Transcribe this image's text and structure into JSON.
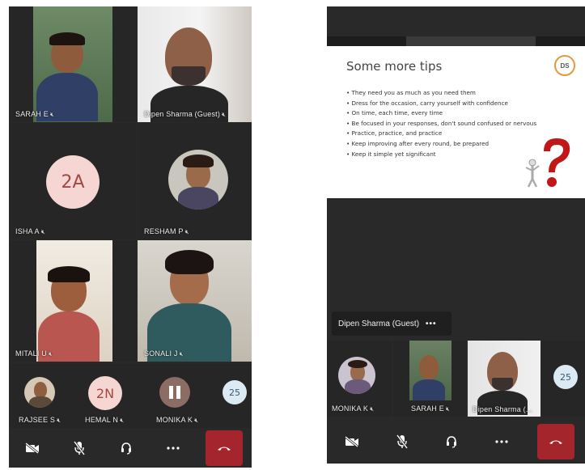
{
  "left": {
    "grid": [
      {
        "name": "SARAH E"
      },
      {
        "name": "Dipen Sharma (Guest)"
      },
      {
        "name": "ISHA A",
        "initials": "2A"
      },
      {
        "name": "RESHAM P"
      },
      {
        "name": "MITALI U"
      },
      {
        "name": "SONALI J"
      }
    ],
    "strip": [
      {
        "name": "RAJSEE S"
      },
      {
        "name": "HEMAL N",
        "initials": "2N"
      },
      {
        "name": "MONIKA K"
      },
      {
        "overflow": "25"
      }
    ]
  },
  "right": {
    "slide": {
      "title": "Some more tips",
      "logo": "DS",
      "bullets": [
        "• They need you as much as you need them",
        "• Dress for the occasion, carry yourself with confidence",
        "• On time, each time, every time",
        "• Be focused in your responses, don't sound confused or nervous",
        "• Practice, practice, and practice",
        "• Keep improving after every round, be prepared",
        "• Keep it simple yet significant"
      ]
    },
    "presenter": {
      "name": "Dipen Sharma (Guest)",
      "more": "•••"
    },
    "strip": [
      {
        "name": "MONIKA K"
      },
      {
        "name": "SARAH E"
      },
      {
        "name": "Dipen Sharma (..."
      },
      {
        "overflow": "25"
      }
    ]
  },
  "colors": {
    "background": "#292929",
    "hangup": "#a4262c",
    "initials_bg": "#f6d6d2",
    "active_outline": "#6e6fd6"
  },
  "icons": [
    "camera-off-icon",
    "mic-off-icon",
    "headset-icon",
    "more-icon",
    "hang-up-icon"
  ]
}
